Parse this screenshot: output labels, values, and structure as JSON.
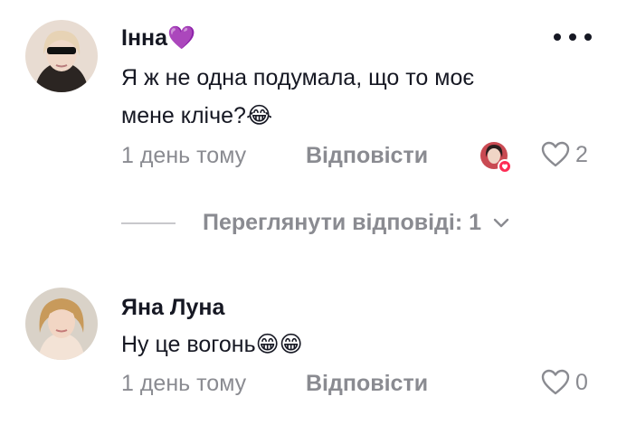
{
  "comments": [
    {
      "username": "Інна💜",
      "text": "Я ж не одна подумала, що то моє\nмене кліче?😂",
      "time": "1 день тому",
      "reply_label": "Відповісти",
      "likes": "2",
      "view_replies": "Переглянути відповіді: 1"
    },
    {
      "username": "Яна Луна",
      "text": "Ну це вогонь😁😁",
      "time": "1 день тому",
      "reply_label": "Відповісти",
      "likes": "0"
    }
  ],
  "colors": {
    "text_primary": "#161823",
    "text_secondary": "#8a8b91",
    "creator_badge": "#fe2c55"
  }
}
